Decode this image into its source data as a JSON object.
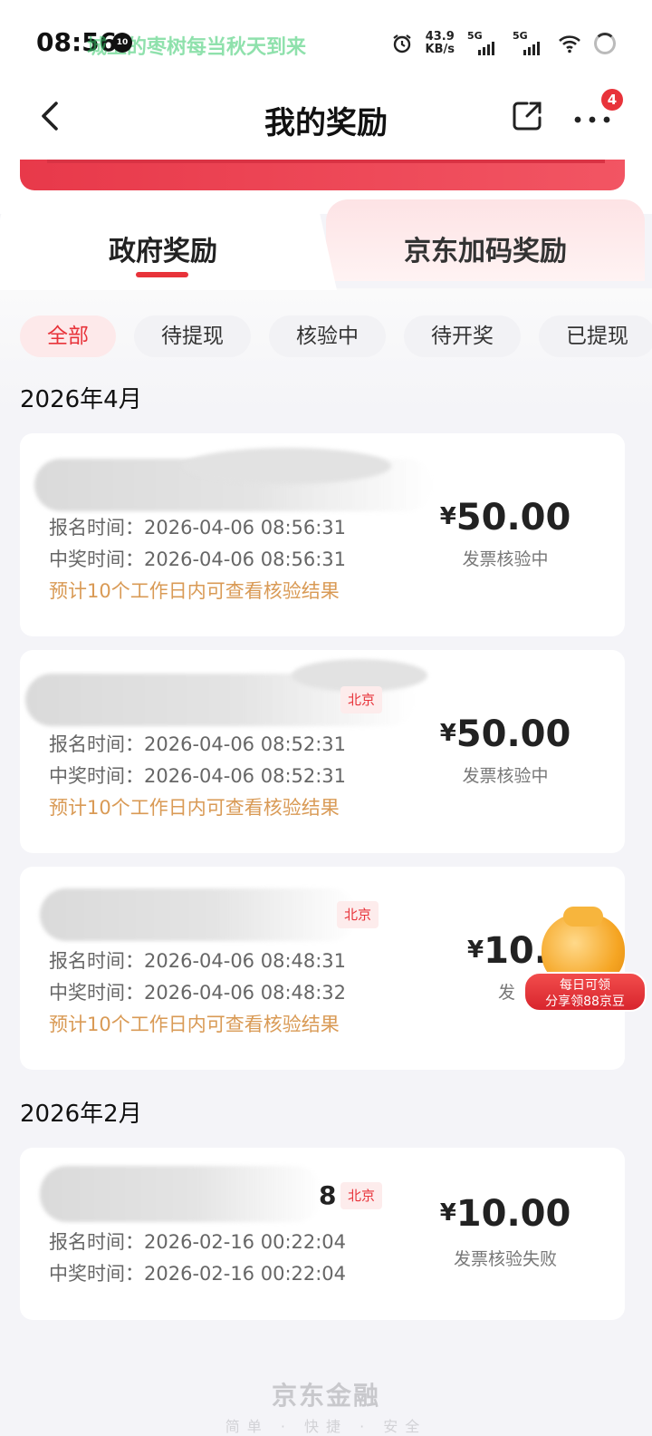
{
  "status_bar": {
    "time": "08:56",
    "notif_badge": "10",
    "lyric": "城上的枣树每当秋天到来",
    "speed_value": "43.9",
    "speed_unit": "KB/s",
    "sig1_label": "5G",
    "sig2_label": "5G"
  },
  "header": {
    "title": "我的奖励",
    "more_badge": "4"
  },
  "tabs": [
    {
      "label": "政府奖励",
      "active": true
    },
    {
      "label": "京东加码奖励",
      "active": false
    }
  ],
  "filters": [
    {
      "label": "全部",
      "active": true
    },
    {
      "label": "待提现",
      "active": false
    },
    {
      "label": "核验中",
      "active": false
    },
    {
      "label": "待开奖",
      "active": false
    },
    {
      "label": "已提现",
      "active": false
    }
  ],
  "groups": [
    {
      "month": "2026年4月",
      "items": [
        {
          "partial_id": "",
          "location": "",
          "signup": "报名时间：2026-04-06 08:56:31",
          "win": "中奖时间：2026-04-06 08:56:31",
          "note": "预计10个工作日内可查看核验结果",
          "currency": "¥",
          "amount": "50.00",
          "status": "发票核验中"
        },
        {
          "partial_id": "",
          "location": "北京",
          "signup": "报名时间：2026-04-06 08:52:31",
          "win": "中奖时间：2026-04-06 08:52:31",
          "note": "预计10个工作日内可查看核验结果",
          "currency": "¥",
          "amount": "50.00",
          "status": "发票核验中"
        },
        {
          "partial_id": "",
          "location": "北京",
          "signup": "报名时间：2026-04-06 08:48:31",
          "win": "中奖时间：2026-04-06 08:48:32",
          "note": "预计10个工作日内可查看核验结果",
          "currency": "¥",
          "amount": "10.0",
          "status": "发"
        }
      ]
    },
    {
      "month": "2026年2月",
      "items": [
        {
          "partial_id": "8",
          "location": "北京",
          "signup": "报名时间：2026-02-16 00:22:04",
          "win": "中奖时间：2026-02-16 00:22:04",
          "currency": "¥",
          "amount": "10.00",
          "status": "发票核验失败"
        }
      ]
    }
  ],
  "promo": {
    "line1": "每日可领",
    "line2": "分享领88京豆"
  },
  "footer": {
    "brand": "京东金融",
    "sub": "简单 · 快捷 · 安全"
  },
  "colors": {
    "accent": "#e8333a",
    "note": "#d99a55"
  },
  "icons": {
    "back": "chevron-left-icon",
    "share": "share-icon",
    "more": "more-dots-icon"
  }
}
